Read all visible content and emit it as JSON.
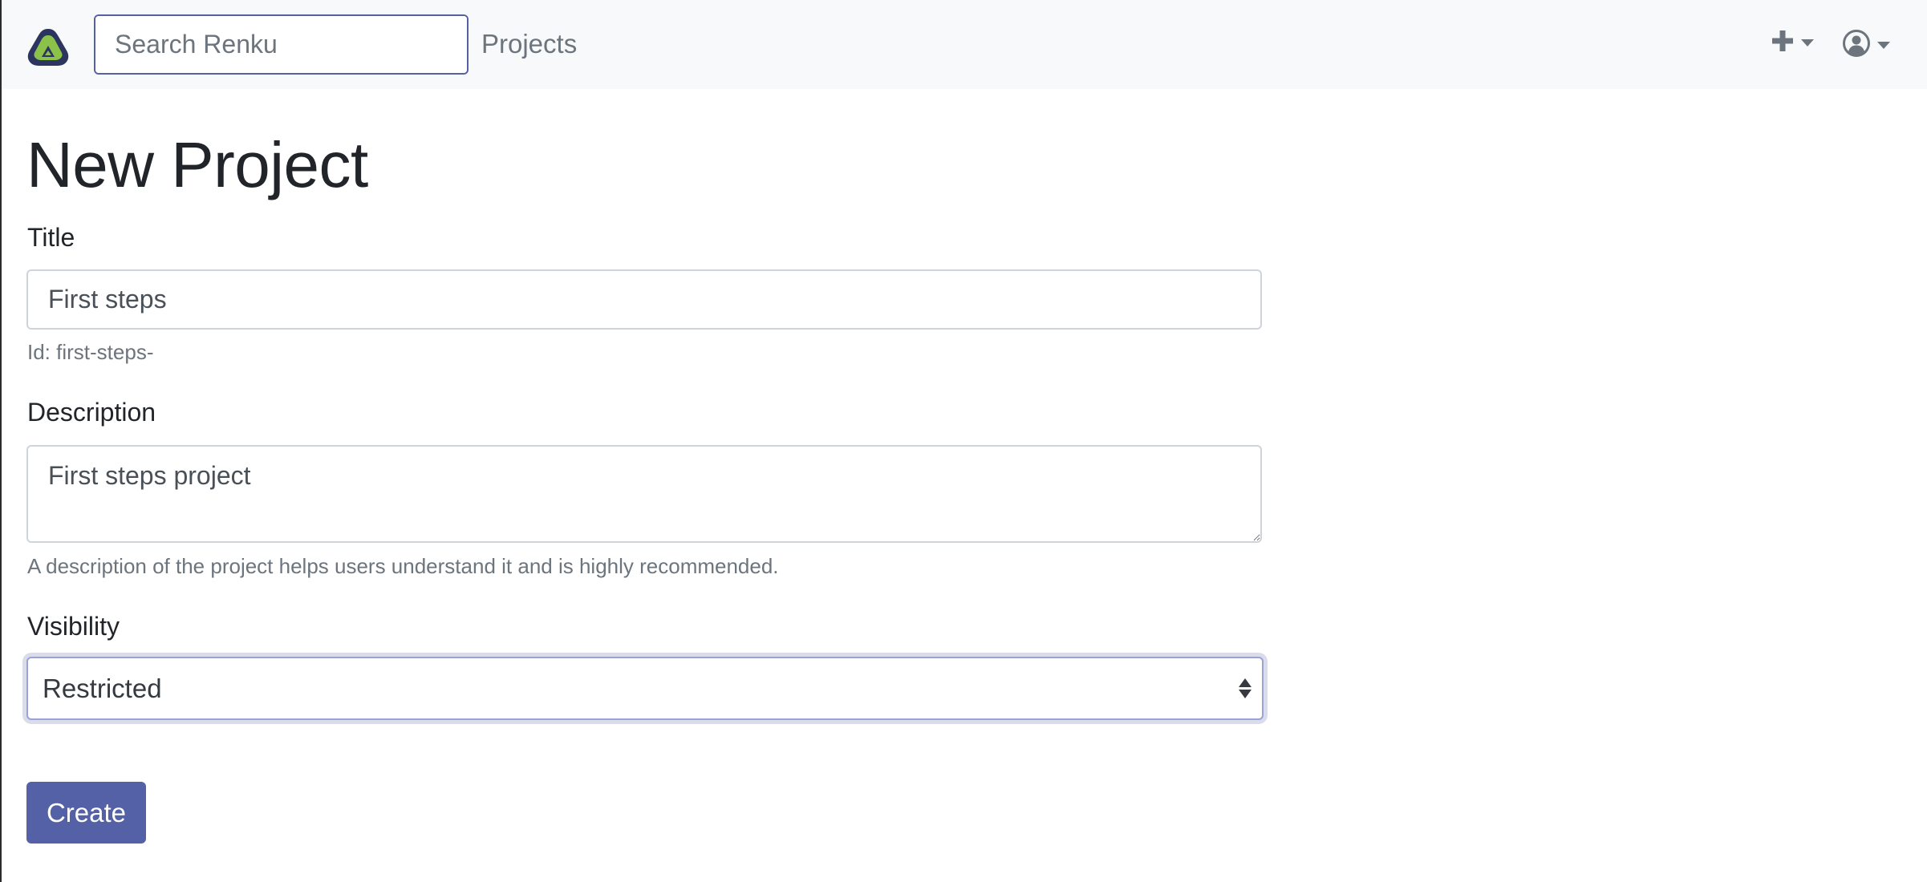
{
  "app": {
    "name": "Renku"
  },
  "navbar": {
    "logo_icon": "renku-logo-icon",
    "search": {
      "placeholder": "Search Renku",
      "value": "",
      "button_icon": "search-icon"
    },
    "links": [
      {
        "label": "Projects"
      }
    ],
    "plus_menu_icon": "plus-icon",
    "user_menu_icon": "user-circle-icon"
  },
  "form": {
    "title": "New Project",
    "title_field": {
      "label": "Title",
      "value": "First steps",
      "id_hint": "Id: first-steps-"
    },
    "description_field": {
      "label": "Description",
      "value": "First steps project",
      "help": "A description of the project helps users understand it and is highly recommended."
    },
    "visibility_field": {
      "label": "Visibility",
      "selected": "Restricted"
    },
    "submit_label": "Create"
  },
  "colors": {
    "primary": "#5561a6",
    "navbar_bg": "#f8f9fa",
    "muted_text": "#6c757d",
    "logo_green": "#8bc34a",
    "logo_navy": "#2c3560"
  }
}
